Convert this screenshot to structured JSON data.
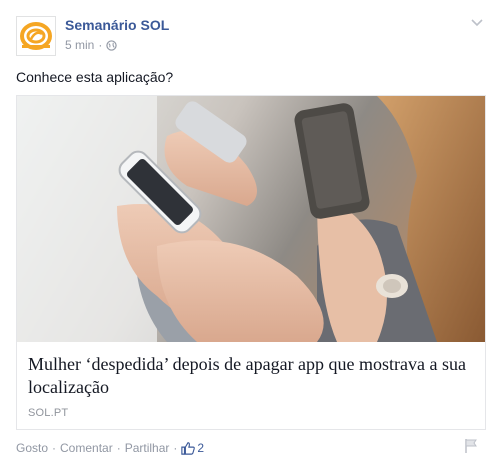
{
  "post": {
    "page_name": "Semanário SOL",
    "time": "5 min",
    "separator": "·",
    "text": "Conhece esta aplicação?"
  },
  "card": {
    "title": "Mulher ‘despedida’ depois de apagar app que mostrava a sua localização",
    "domain": "SOL.PT"
  },
  "actions": {
    "like": "Gosto",
    "comment": "Comentar",
    "share": "Partilhar",
    "dot": "·",
    "like_count": "2"
  },
  "colors": {
    "brand_orange": "#f5a623",
    "link_blue": "#3b5998",
    "meta_grey": "#9197a3"
  },
  "icons": {
    "avatar": "sol-logo",
    "privacy": "globe-icon",
    "menu": "chevron-down-icon",
    "like": "thumbs-up-icon",
    "report": "flag-icon"
  }
}
